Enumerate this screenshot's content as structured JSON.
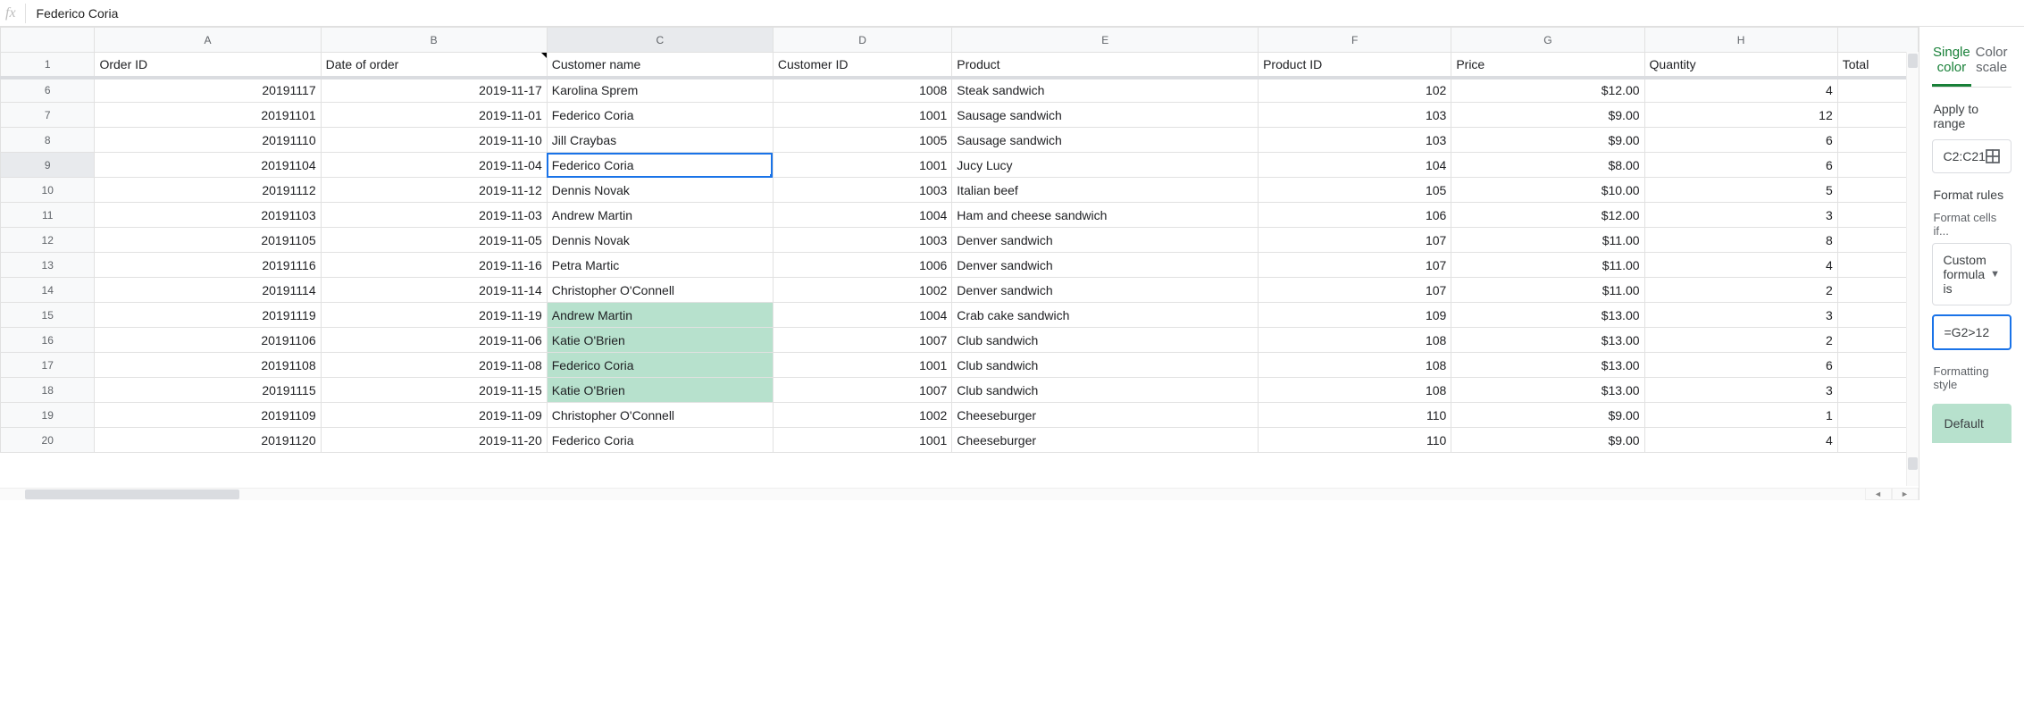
{
  "formula_bar": {
    "fx_label": "fx",
    "content": "Federico Coria"
  },
  "columns": [
    "A",
    "B",
    "C",
    "D",
    "E",
    "F",
    "G",
    "H",
    ""
  ],
  "header_row_num": "1",
  "headers": {
    "A": "Order ID",
    "B": "Date of order",
    "C": "Customer name",
    "D": "Customer ID",
    "E": "Product",
    "F": "Product ID",
    "G": "Price",
    "H": "Quantity",
    "I": "Total"
  },
  "visible_rows": [
    {
      "n": "6",
      "A": "20191117",
      "B": "2019-11-17",
      "C": "Karolina Sprem",
      "D": "1008",
      "E": "Steak sandwich",
      "F": "102",
      "G": "$12.00",
      "H": "4"
    },
    {
      "n": "7",
      "A": "20191101",
      "B": "2019-11-01",
      "C": "Federico Coria",
      "D": "1001",
      "E": "Sausage sandwich",
      "F": "103",
      "G": "$9.00",
      "H": "12"
    },
    {
      "n": "8",
      "A": "20191110",
      "B": "2019-11-10",
      "C": "Jill Craybas",
      "D": "1005",
      "E": "Sausage sandwich",
      "F": "103",
      "G": "$9.00",
      "H": "6"
    },
    {
      "n": "9",
      "A": "20191104",
      "B": "2019-11-04",
      "C": "Federico Coria",
      "D": "1001",
      "E": "Jucy Lucy",
      "F": "104",
      "G": "$8.00",
      "H": "6",
      "sel": true
    },
    {
      "n": "10",
      "A": "20191112",
      "B": "2019-11-12",
      "C": "Dennis Novak",
      "D": "1003",
      "E": "Italian beef",
      "F": "105",
      "G": "$10.00",
      "H": "5"
    },
    {
      "n": "11",
      "A": "20191103",
      "B": "2019-11-03",
      "C": "Andrew Martin",
      "D": "1004",
      "E": "Ham and cheese sandwich",
      "F": "106",
      "G": "$12.00",
      "H": "3"
    },
    {
      "n": "12",
      "A": "20191105",
      "B": "2019-11-05",
      "C": "Dennis Novak",
      "D": "1003",
      "E": "Denver sandwich",
      "F": "107",
      "G": "$11.00",
      "H": "8"
    },
    {
      "n": "13",
      "A": "20191116",
      "B": "2019-11-16",
      "C": "Petra Martic",
      "D": "1006",
      "E": "Denver sandwich",
      "F": "107",
      "G": "$11.00",
      "H": "4"
    },
    {
      "n": "14",
      "A": "20191114",
      "B": "2019-11-14",
      "C": "Christopher O'Connell",
      "D": "1002",
      "E": "Denver sandwich",
      "F": "107",
      "G": "$11.00",
      "H": "2"
    },
    {
      "n": "15",
      "A": "20191119",
      "B": "2019-11-19",
      "C": "Andrew Martin",
      "D": "1004",
      "E": "Crab cake sandwich",
      "F": "109",
      "G": "$13.00",
      "H": "3",
      "hl": true
    },
    {
      "n": "16",
      "A": "20191106",
      "B": "2019-11-06",
      "C": "Katie O'Brien",
      "D": "1007",
      "E": "Club sandwich",
      "F": "108",
      "G": "$13.00",
      "H": "2",
      "hl": true
    },
    {
      "n": "17",
      "A": "20191108",
      "B": "2019-11-08",
      "C": "Federico Coria",
      "D": "1001",
      "E": "Club sandwich",
      "F": "108",
      "G": "$13.00",
      "H": "6",
      "hl": true
    },
    {
      "n": "18",
      "A": "20191115",
      "B": "2019-11-15",
      "C": "Katie O'Brien",
      "D": "1007",
      "E": "Club sandwich",
      "F": "108",
      "G": "$13.00",
      "H": "3",
      "hl": true
    },
    {
      "n": "19",
      "A": "20191109",
      "B": "2019-11-09",
      "C": "Christopher O'Connell",
      "D": "1002",
      "E": "Cheeseburger",
      "F": "110",
      "G": "$9.00",
      "H": "1"
    },
    {
      "n": "20",
      "A": "20191120",
      "B": "2019-11-20",
      "C": "Federico Coria",
      "D": "1001",
      "E": "Cheeseburger",
      "F": "110",
      "G": "$9.00",
      "H": "4"
    }
  ],
  "side": {
    "tab_single": "Single color",
    "tab_scale": "Color scale",
    "apply_label": "Apply to range",
    "range_value": "C2:C21",
    "rules_label": "Format rules",
    "cells_if_label": "Format cells if...",
    "condition_value": "Custom formula is",
    "formula_value": "=G2>12",
    "style_label": "Formatting style",
    "default_label": "Default"
  },
  "colors": {
    "highlight": "#b7e1cd",
    "selection": "#1a73e8",
    "active_tab": "#188038"
  }
}
